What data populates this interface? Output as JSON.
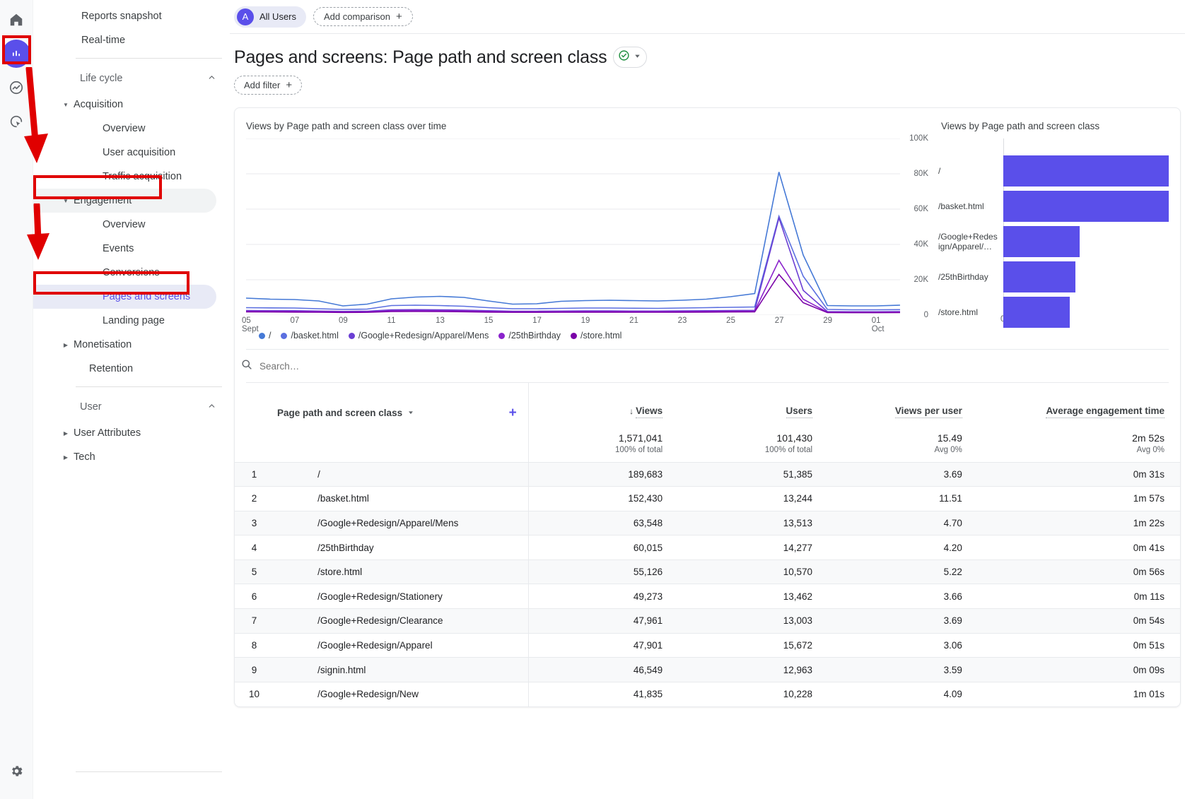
{
  "rail": {
    "items": [
      {
        "name": "home-icon",
        "label": "Home"
      },
      {
        "name": "reports-icon",
        "label": "Reports"
      },
      {
        "name": "explore-icon",
        "label": "Explore"
      },
      {
        "name": "advertising-icon",
        "label": "Advertising"
      }
    ],
    "settings_label": "Admin",
    "active_index": 1
  },
  "sidebar": {
    "top_items": [
      {
        "label": "Reports snapshot"
      },
      {
        "label": "Real-time"
      }
    ],
    "sections": [
      {
        "label": "Life cycle",
        "expanded": true,
        "groups": [
          {
            "label": "Acquisition",
            "expanded": true,
            "children": [
              {
                "label": "Overview"
              },
              {
                "label": "User acquisition"
              },
              {
                "label": "Traffic acquisition"
              }
            ]
          },
          {
            "label": "Engagement",
            "expanded": true,
            "highlighted": true,
            "children": [
              {
                "label": "Overview"
              },
              {
                "label": "Events"
              },
              {
                "label": "Conversions"
              },
              {
                "label": "Pages and screens",
                "selected": true
              },
              {
                "label": "Landing page"
              }
            ]
          },
          {
            "label": "Monetisation",
            "expanded": false,
            "children": []
          },
          {
            "label": "Retention",
            "leaf": true,
            "children": []
          }
        ]
      },
      {
        "label": "User",
        "expanded": true,
        "groups": [
          {
            "label": "User Attributes",
            "expanded": false,
            "children": []
          },
          {
            "label": "Tech",
            "expanded": false,
            "children": []
          }
        ]
      }
    ]
  },
  "topbar": {
    "all_users_label": "All Users",
    "all_users_initial": "A",
    "add_comparison_label": "Add comparison"
  },
  "header": {
    "title": "Pages and screens: Page path and screen class",
    "add_filter_label": "Add filter"
  },
  "search": {
    "placeholder": "Search…",
    "value": ""
  },
  "colors": {
    "accent": "#5a4fea",
    "bar": "#5a4fea",
    "series": [
      "#4579d6",
      "#5b6fe0",
      "#6b3fd4",
      "#8a22cc",
      "#7a00a8"
    ],
    "annotation": "#e00000"
  },
  "chart_data": [
    {
      "type": "line",
      "title": "Views by Page path and screen class over time",
      "xlabel": "",
      "ylabel": "",
      "ylim": [
        0,
        100000
      ],
      "yticks": [
        0,
        20000,
        40000,
        60000,
        80000,
        100000
      ],
      "ytick_labels": [
        "0",
        "20K",
        "40K",
        "60K",
        "80K",
        "100K"
      ],
      "grid": true,
      "legend_position": "bottom",
      "x": [
        "05 Sept",
        "06",
        "07",
        "08",
        "09",
        "10",
        "11",
        "12",
        "13",
        "14",
        "15",
        "16",
        "17",
        "18",
        "19",
        "20",
        "21",
        "22",
        "23",
        "24",
        "25",
        "26",
        "27",
        "28",
        "29",
        "30",
        "01 Oct",
        "02"
      ],
      "xtick_labels": [
        "05",
        "07",
        "09",
        "11",
        "13",
        "15",
        "17",
        "19",
        "21",
        "23",
        "25",
        "27",
        "29",
        "01"
      ],
      "xtick_sublabels": [
        "Sept",
        "",
        "",
        "",
        "",
        "",
        "",
        "",
        "",
        "",
        "",
        "",
        "",
        "Oct"
      ],
      "series": [
        {
          "name": "/",
          "color": "#4579d6",
          "values": [
            9600,
            9000,
            8800,
            8000,
            5200,
            6200,
            9200,
            10200,
            10600,
            10000,
            8000,
            6200,
            6400,
            7800,
            8200,
            8400,
            8200,
            8000,
            8400,
            9000,
            10400,
            12200,
            81000,
            34000,
            5400,
            5200,
            5200,
            5600
          ]
        },
        {
          "name": "/basket.html",
          "color": "#5b6fe0",
          "values": [
            4200,
            4100,
            4000,
            3600,
            3200,
            3400,
            5400,
            5600,
            5400,
            5000,
            4200,
            3600,
            3600,
            3800,
            4000,
            4000,
            3900,
            3800,
            4000,
            4200,
            4400,
            4600,
            56000,
            22000,
            3200,
            3000,
            3000,
            3100
          ]
        },
        {
          "name": "/Google+Redesign/Apparel/Mens",
          "color": "#6b3fd4",
          "values": [
            2600,
            2500,
            2500,
            2300,
            2100,
            2200,
            3000,
            3100,
            3000,
            2800,
            2500,
            2200,
            2200,
            2300,
            2400,
            2400,
            2300,
            2300,
            2400,
            2500,
            2600,
            2700,
            55000,
            14000,
            2000,
            1900,
            1900,
            2000
          ]
        },
        {
          "name": "/25thBirthday",
          "color": "#8a22cc",
          "values": [
            2200,
            2150,
            2100,
            2000,
            1800,
            1900,
            2500,
            2600,
            2500,
            2400,
            2100,
            1900,
            1900,
            2000,
            2050,
            2050,
            2000,
            2000,
            2050,
            2100,
            2200,
            2300,
            31000,
            9000,
            1700,
            1650,
            1650,
            1700
          ]
        },
        {
          "name": "/store.html",
          "color": "#7a00a8",
          "values": [
            1800,
            1750,
            1700,
            1600,
            1500,
            1550,
            2000,
            2100,
            2000,
            1900,
            1700,
            1550,
            1550,
            1600,
            1650,
            1650,
            1600,
            1600,
            1650,
            1700,
            1750,
            1800,
            23000,
            7000,
            1400,
            1350,
            1350,
            1400
          ]
        }
      ]
    },
    {
      "type": "bar",
      "orientation": "horizontal",
      "title": "Views by Page path and screen class",
      "categories": [
        "/",
        "/basket.html",
        "/Google+Redes\nign/Apparel/…",
        "/25thBirthday",
        "/store.html"
      ],
      "values": [
        189683,
        152430,
        63548,
        60015,
        55126
      ],
      "xlim": [
        0,
        200000
      ],
      "xtick_labels": [
        "0"
      ],
      "bar_color": "#5a4fea"
    }
  ],
  "table": {
    "dimension_header": "Page path and screen class",
    "columns": [
      {
        "label": "Views",
        "sorted": true,
        "sort_dir": "desc"
      },
      {
        "label": "Users"
      },
      {
        "label": "Views per user"
      },
      {
        "label": "Average engagement time"
      }
    ],
    "totals": [
      {
        "value": "1,571,041",
        "sub": "100% of total"
      },
      {
        "value": "101,430",
        "sub": "100% of total"
      },
      {
        "value": "15.49",
        "sub": "Avg 0%"
      },
      {
        "value": "2m 52s",
        "sub": "Avg 0%"
      }
    ],
    "rows": [
      {
        "index": "1",
        "dimension": "/",
        "views": "189,683",
        "users": "51,385",
        "views_per_user": "3.69",
        "avg_engagement": "0m 31s"
      },
      {
        "index": "2",
        "dimension": "/basket.html",
        "views": "152,430",
        "users": "13,244",
        "views_per_user": "11.51",
        "avg_engagement": "1m 57s"
      },
      {
        "index": "3",
        "dimension": "/Google+Redesign/Apparel/Mens",
        "views": "63,548",
        "users": "13,513",
        "views_per_user": "4.70",
        "avg_engagement": "1m 22s"
      },
      {
        "index": "4",
        "dimension": "/25thBirthday",
        "views": "60,015",
        "users": "14,277",
        "views_per_user": "4.20",
        "avg_engagement": "0m 41s"
      },
      {
        "index": "5",
        "dimension": "/store.html",
        "views": "55,126",
        "users": "10,570",
        "views_per_user": "5.22",
        "avg_engagement": "0m 56s"
      },
      {
        "index": "6",
        "dimension": "/Google+Redesign/Stationery",
        "views": "49,273",
        "users": "13,462",
        "views_per_user": "3.66",
        "avg_engagement": "0m 11s"
      },
      {
        "index": "7",
        "dimension": "/Google+Redesign/Clearance",
        "views": "47,961",
        "users": "13,003",
        "views_per_user": "3.69",
        "avg_engagement": "0m 54s"
      },
      {
        "index": "8",
        "dimension": "/Google+Redesign/Apparel",
        "views": "47,901",
        "users": "15,672",
        "views_per_user": "3.06",
        "avg_engagement": "0m 51s"
      },
      {
        "index": "9",
        "dimension": "/signin.html",
        "views": "46,549",
        "users": "12,963",
        "views_per_user": "3.59",
        "avg_engagement": "0m 09s"
      },
      {
        "index": "10",
        "dimension": "/Google+Redesign/New",
        "views": "41,835",
        "users": "10,228",
        "views_per_user": "4.09",
        "avg_engagement": "1m 01s"
      }
    ]
  }
}
